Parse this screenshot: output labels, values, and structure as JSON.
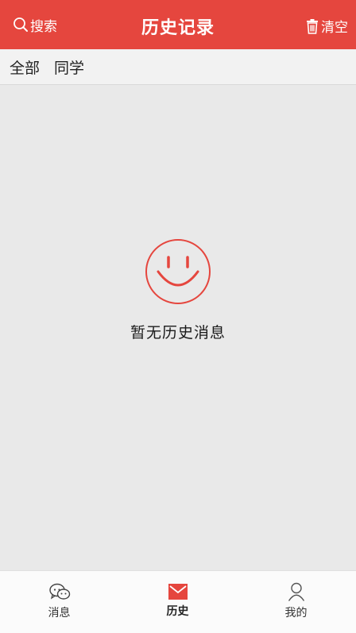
{
  "header": {
    "search_label": "搜索",
    "title": "历史记录",
    "clear_label": "清空"
  },
  "filters": [
    {
      "label": "全部"
    },
    {
      "label": "同学"
    }
  ],
  "empty_state": {
    "message": "暂无历史消息",
    "icon": "smiley-face-icon"
  },
  "tabs": [
    {
      "label": "消息",
      "icon": "chat-bubbles-icon"
    },
    {
      "label": "历史",
      "icon": "envelope-icon",
      "active": true
    },
    {
      "label": "我的",
      "icon": "person-icon"
    }
  ],
  "colors": {
    "accent": "#e5463e",
    "background": "#e9e9e9"
  }
}
